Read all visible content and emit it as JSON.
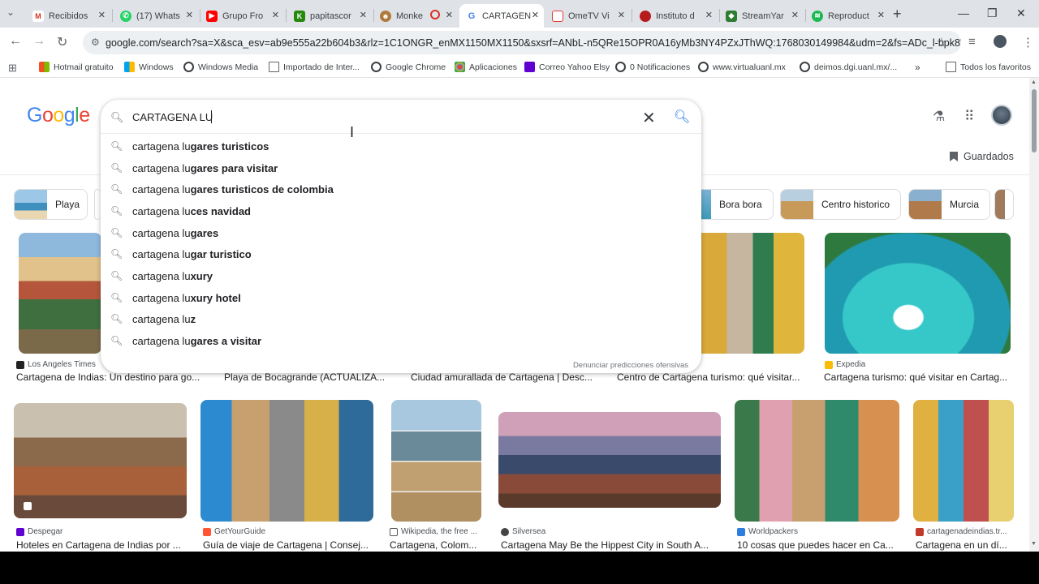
{
  "tabs": [
    {
      "label": "Recibidos",
      "icon": "gmail-icon",
      "color": "#d93025",
      "glyph": "M",
      "active": false
    },
    {
      "label": "(17) Whats",
      "icon": "whatsapp-icon",
      "color": "#25d366",
      "glyph": "✆",
      "active": false
    },
    {
      "label": "Grupo Fro",
      "icon": "youtube-icon",
      "color": "#ff0000",
      "glyph": "▶",
      "active": false
    },
    {
      "label": "papitascor",
      "icon": "kahoot-icon",
      "color": "#26890c",
      "glyph": "K",
      "active": false
    },
    {
      "label": "Monke",
      "icon": "monkey-icon",
      "color": "#b07a3c",
      "glyph": "☻",
      "active": false
    },
    {
      "label": "CARTAGEN",
      "icon": "google-icon",
      "color": "#4285f4",
      "glyph": "G",
      "active": true
    },
    {
      "label": "OmeTV Vi",
      "icon": "ometv-icon",
      "color": "#e53935",
      "glyph": "▭",
      "active": false
    },
    {
      "label": "Instituto d",
      "icon": "instituto-icon",
      "color": "#b71c1c",
      "glyph": "◐",
      "active": false
    },
    {
      "label": "StreamYar",
      "icon": "streamyard-icon",
      "color": "#2e7d32",
      "glyph": "◆",
      "active": false
    },
    {
      "label": "Reproduct",
      "icon": "spotify-icon",
      "color": "#1db954",
      "glyph": "≋",
      "active": false
    }
  ],
  "url": "google.com/search?sa=X&sca_esv=ab9e555a22b604b3&rlz=1C1ONGR_enMX1150MX1150&sxsrf=ANbL-n5QRe15OPR0A16yMb3NY4PZxJThWQ:1768030149984&udm=2&fs=ADc_l-bpk8W4E-...",
  "bookmarks": [
    {
      "label": "Hotmail gratuito",
      "icon": "windows-icon",
      "color": "#f25022"
    },
    {
      "label": "Windows",
      "icon": "windows-icon",
      "color": "#7fba00"
    },
    {
      "label": "Windows Media",
      "icon": "globe-icon",
      "color": "#3c4043"
    },
    {
      "label": "Importado de Inter...",
      "icon": "folder-icon",
      "color": "#5f6368"
    },
    {
      "label": "Google Chrome",
      "icon": "globe-icon",
      "color": "#3c4043"
    },
    {
      "label": "Aplicaciones",
      "icon": "apps-icon",
      "color": "#ea4335"
    },
    {
      "label": "Correo Yahoo Elsy",
      "icon": "yahoo-icon",
      "color": "#6001d2"
    },
    {
      "label": "0 Notificaciones",
      "icon": "globe-icon",
      "color": "#3c4043"
    },
    {
      "label": "www.virtualuanl.mx",
      "icon": "globe-icon",
      "color": "#3c4043"
    },
    {
      "label": "deimos.dgi.uanl.mx/...",
      "icon": "globe-icon",
      "color": "#3c4043"
    }
  ],
  "all_bookmarks": "Todos los favoritos",
  "search": {
    "query": "CARTAGENA LU",
    "report": "Denunciar predicciones ofensivas",
    "suggestions": [
      {
        "prefix": "cartagena lu",
        "rest": "gares turisticos"
      },
      {
        "prefix": "cartagena lu",
        "rest": "gares para visitar"
      },
      {
        "prefix": "cartagena lu",
        "rest": "gares turisticos de colombia"
      },
      {
        "prefix": "cartagena lu",
        "rest": "ces navidad"
      },
      {
        "prefix": "cartagena lu",
        "rest": "gares"
      },
      {
        "prefix": "cartagena lu",
        "rest": "gar turistico"
      },
      {
        "prefix": "cartagena lu",
        "rest": "xury"
      },
      {
        "prefix": "cartagena lu",
        "rest": "xury hotel"
      },
      {
        "prefix": "cartagena lu",
        "rest": "z"
      },
      {
        "prefix": "cartagena lu",
        "rest": "gares a visitar"
      }
    ]
  },
  "saved_label": "Guardados",
  "chips": [
    "Playa",
    "Bora bora",
    "Centro historico",
    "Murcia"
  ],
  "images_row1": [
    {
      "source": "Los Angeles Times",
      "caption": "Cartagena de Indias: Un destino para go..."
    },
    {
      "source": "",
      "caption": "Playa de Bocagrande (ACTUALIZA..."
    },
    {
      "source": "",
      "caption": "Ciudad amurallada de Cartagena | Desc..."
    },
    {
      "source": "",
      "caption": "Centro de Cartagena turismo: qué visitar..."
    },
    {
      "source": "Expedia",
      "caption": "Cartagena turismo: qué visitar en Cartag..."
    }
  ],
  "images_row2": [
    {
      "source": "Despegar",
      "caption": "Hoteles en Cartagena de Indias por ..."
    },
    {
      "source": "GetYourGuide",
      "caption": "Guía de viaje de Cartagena | Consej..."
    },
    {
      "source": "Wikipedia, the free ...",
      "caption": "Cartagena, Colom..."
    },
    {
      "source": "Silversea",
      "caption": "Cartagena May Be the Hippest City in South A..."
    },
    {
      "source": "Worldpackers",
      "caption": "10 cosas que puedes hacer en Ca..."
    },
    {
      "source": "cartagenadeindias.tr...",
      "caption": "Cartagena en un dí..."
    }
  ]
}
